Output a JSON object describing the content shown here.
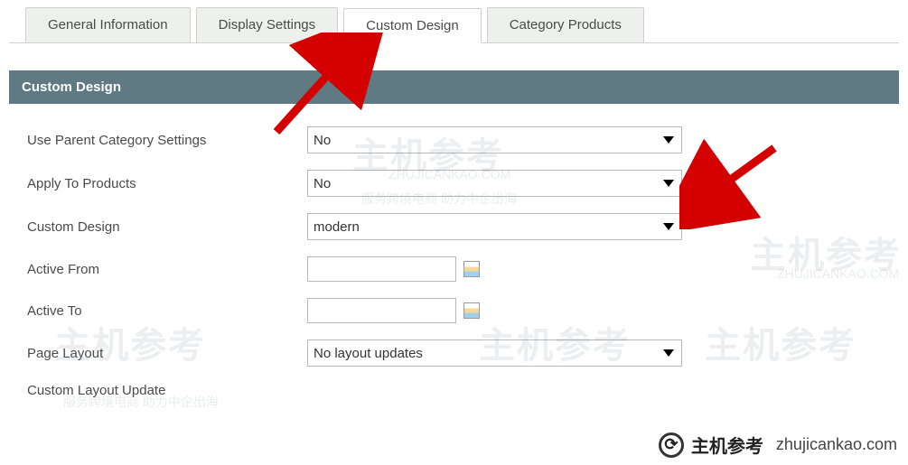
{
  "tabs": [
    {
      "label": "General Information",
      "active": false
    },
    {
      "label": "Display Settings",
      "active": false
    },
    {
      "label": "Custom Design",
      "active": true
    },
    {
      "label": "Category Products",
      "active": false
    }
  ],
  "section": {
    "title": "Custom Design"
  },
  "form": {
    "use_parent": {
      "label": "Use Parent Category Settings",
      "value": "No"
    },
    "apply_products": {
      "label": "Apply To Products",
      "value": "No"
    },
    "custom_design": {
      "label": "Custom Design",
      "value": "modern"
    },
    "active_from": {
      "label": "Active From",
      "value": ""
    },
    "active_to": {
      "label": "Active To",
      "value": ""
    },
    "page_layout": {
      "label": "Page Layout",
      "value": "No layout updates"
    },
    "custom_layout": {
      "label": "Custom Layout Update"
    }
  },
  "watermark": {
    "brand": "主机参考",
    "sub1": "ZHUJICANKAO.COM",
    "sub2": "服务跨境电商 助力中企出海",
    "footer_domain": "zhujicankao.com"
  }
}
